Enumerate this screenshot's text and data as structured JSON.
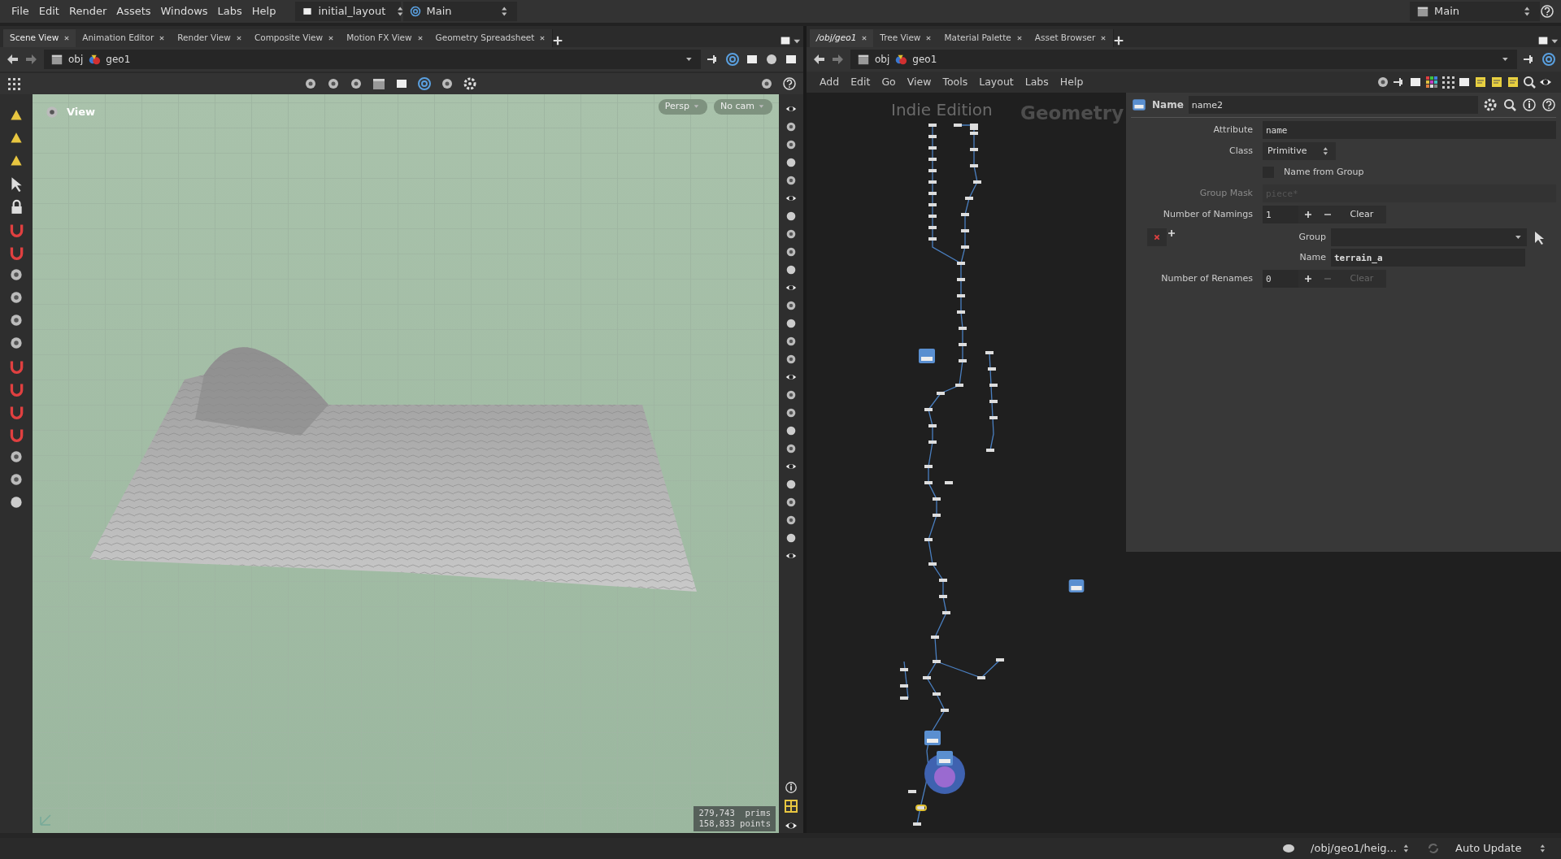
{
  "menu_bar": {
    "items": [
      "File",
      "Edit",
      "Render",
      "Assets",
      "Windows",
      "Labs",
      "Help"
    ],
    "layout_selector": "initial_layout",
    "desktop_selector": "Main",
    "right_selector": "Main"
  },
  "left_pane": {
    "tabs": [
      {
        "label": "Scene View",
        "selected": true
      },
      {
        "label": "Animation Editor",
        "selected": false
      },
      {
        "label": "Render View",
        "selected": false
      },
      {
        "label": "Composite View",
        "selected": false
      },
      {
        "label": "Motion FX View",
        "selected": false
      },
      {
        "label": "Geometry Spreadsheet",
        "selected": false
      }
    ],
    "path": [
      "obj",
      "geo1"
    ],
    "viewport": {
      "title": "View",
      "camera_menus": [
        "Persp",
        "No cam"
      ],
      "stats": [
        "279,743  prims",
        "158,833 points"
      ]
    }
  },
  "right_pane": {
    "tabs": [
      {
        "label": "/obj/geo1",
        "selected": true
      },
      {
        "label": "Tree View",
        "selected": false
      },
      {
        "label": "Material Palette",
        "selected": false
      },
      {
        "label": "Asset Browser",
        "selected": false
      }
    ],
    "path": [
      "obj",
      "geo1"
    ],
    "menu": [
      "Add",
      "Edit",
      "Go",
      "View",
      "Tools",
      "Layout",
      "Labs",
      "Help"
    ],
    "network": {
      "watermark": "Indie Edition",
      "context_label": "Geometry"
    },
    "parameters": {
      "node_type": "Name",
      "node_name": "name2",
      "rows": [
        {
          "kind": "field",
          "label": "Attribute",
          "value": "name"
        },
        {
          "kind": "select",
          "label": "Class",
          "value": "Primitive"
        },
        {
          "kind": "checkbox",
          "label": "Name from Group",
          "checked": false
        },
        {
          "kind": "field",
          "label": "Group Mask",
          "placeholder": "piece*",
          "disabled": true
        },
        {
          "kind": "multiparm",
          "label": "Number of Namings",
          "value": "1",
          "clear": "Clear",
          "disabled": false,
          "entries": [
            {
              "group_label": "Group",
              "name_label": "Name",
              "name_value": "terrain_a"
            }
          ]
        },
        {
          "kind": "multiparm",
          "label": "Number of Renames",
          "value": "0",
          "clear": "Clear",
          "disabled": true,
          "entries": []
        }
      ]
    }
  },
  "status_bar": {
    "node_path": "/obj/geo1/heig...",
    "update_mode": "Auto Update"
  }
}
